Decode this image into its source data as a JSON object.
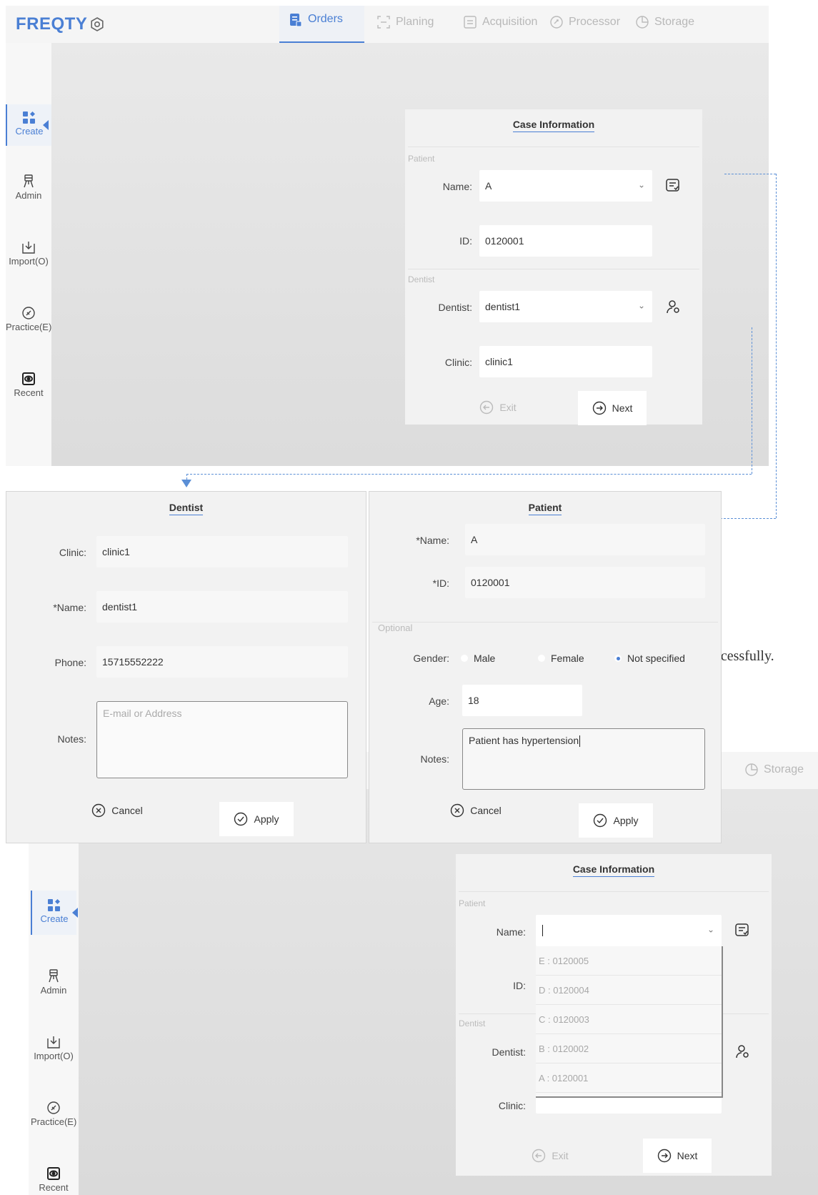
{
  "app": {
    "logo": "FREQTY",
    "tabs": [
      {
        "label": "Orders",
        "icon": "orders-icon",
        "active": true
      },
      {
        "label": "Planing",
        "icon": "planing-icon"
      },
      {
        "label": "Acquisition",
        "icon": "acquisition-icon"
      },
      {
        "label": "Processor",
        "icon": "processor-icon"
      },
      {
        "label": "Storage",
        "icon": "storage-icon"
      }
    ],
    "sidebar": [
      {
        "label": "Create",
        "icon": "create-icon",
        "active": true
      },
      {
        "label": "Admin",
        "icon": "admin-icon"
      },
      {
        "label": "Import(O)",
        "icon": "import-icon"
      },
      {
        "label": "Practice(E)",
        "icon": "practice-icon"
      },
      {
        "label": "Recent",
        "icon": "recent-icon"
      }
    ],
    "accent": "#4a7fd4"
  },
  "case_info": {
    "title": "Case Information",
    "patient_section": "Patient",
    "dentist_section": "Dentist",
    "name_label": "Name:",
    "name_value": "A",
    "id_label": "ID:",
    "id_value": "0120001",
    "dentist_label": "Dentist:",
    "dentist_value": "dentist1",
    "clinic_label": "Clinic:",
    "clinic_value": "clinic1",
    "exit_label": "Exit",
    "next_label": "Next"
  },
  "dentist_dialog": {
    "title": "Dentist",
    "clinic_label": "Clinic:",
    "clinic_value": "clinic1",
    "name_label": "*Name:",
    "name_value": "dentist1",
    "phone_label": "Phone:",
    "phone_value": "15715552222",
    "notes_label": "Notes:",
    "notes_placeholder": "E-mail or Address",
    "cancel_label": "Cancel",
    "apply_label": "Apply"
  },
  "patient_dialog": {
    "title": "Patient",
    "name_label": "*Name:",
    "name_value": "A",
    "id_label": "*ID:",
    "id_value": "0120001",
    "optional_section": "Optional",
    "gender_label": "Gender:",
    "gender_options": [
      "Male",
      "Female",
      "Not specified"
    ],
    "gender_selected": "Not specified",
    "age_label": "Age:",
    "age_value": "18",
    "notes_label": "Notes:",
    "notes_value": "Patient has hypertension",
    "cancel_label": "Cancel",
    "apply_label": "Apply"
  },
  "background_fragments": {
    "text_fragment": "ccessfully.",
    "storage_tab": "Storage"
  },
  "case_info_2": {
    "title": "Case Information",
    "patient_section": "Patient",
    "dentist_section": "Dentist",
    "name_label": "Name:",
    "id_label": "ID:",
    "dentist_label": "Dentist:",
    "clinic_label": "Clinic:",
    "exit_label": "Exit",
    "next_label": "Next",
    "dropdown_items": [
      "E : 0120005",
      "D : 0120004",
      "C : 0120003",
      "B : 0120002",
      "A : 0120001"
    ]
  }
}
